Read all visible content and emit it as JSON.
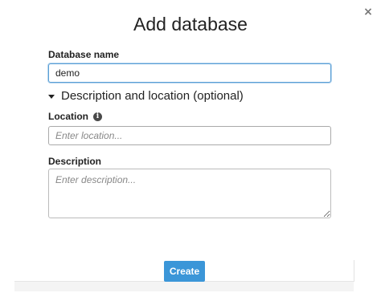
{
  "dialog": {
    "title": "Add database",
    "close_glyph": "×"
  },
  "form": {
    "database_name": {
      "label": "Database name",
      "value": "demo"
    },
    "section_toggle": {
      "label": "Description and location (optional)",
      "state": "expanded",
      "icon": "triangle-down-icon"
    },
    "location": {
      "label": "Location",
      "info_icon": "info-icon",
      "info_glyph": "i",
      "value": "",
      "placeholder": "Enter location..."
    },
    "description": {
      "label": "Description",
      "value": "",
      "placeholder": "Enter description..."
    }
  },
  "footer": {
    "create_label": "Create"
  },
  "colors": {
    "accent": "#3b96d8",
    "focus_border": "#5a9fd6"
  }
}
